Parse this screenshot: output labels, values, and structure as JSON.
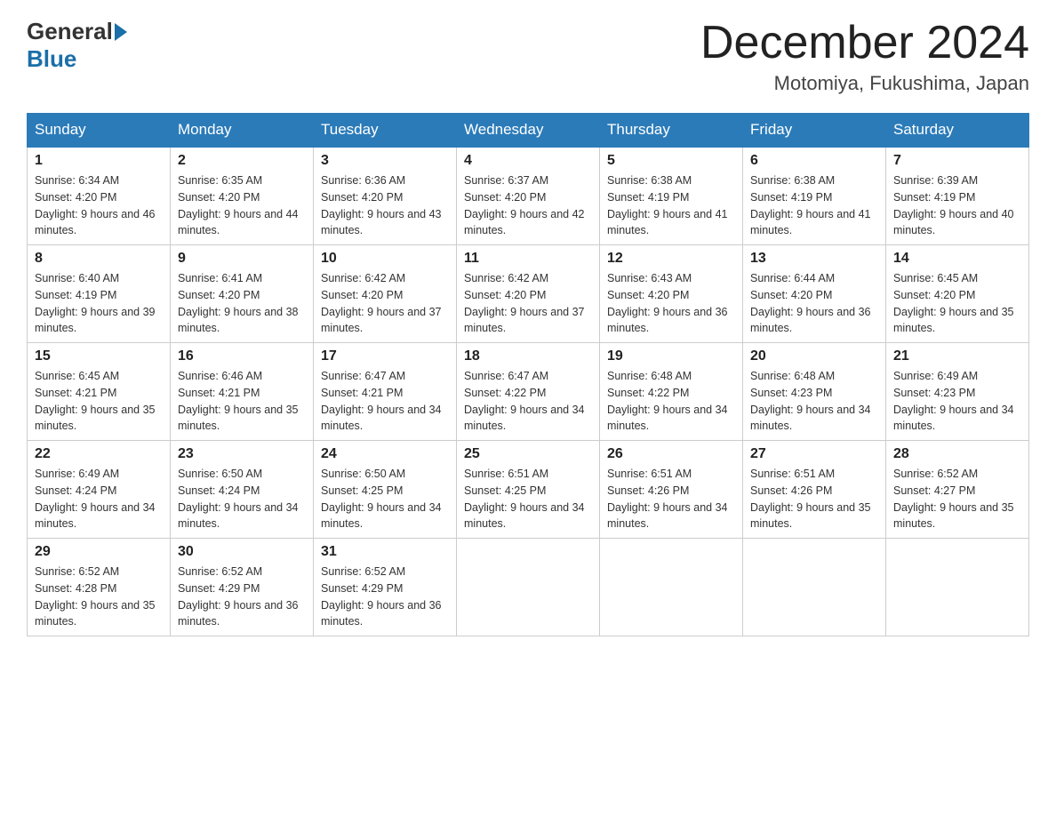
{
  "header": {
    "logo_general": "General",
    "logo_blue": "Blue",
    "month_title": "December 2024",
    "location": "Motomiya, Fukushima, Japan"
  },
  "days_of_week": [
    "Sunday",
    "Monday",
    "Tuesday",
    "Wednesday",
    "Thursday",
    "Friday",
    "Saturday"
  ],
  "weeks": [
    [
      {
        "num": "1",
        "sunrise": "6:34 AM",
        "sunset": "4:20 PM",
        "daylight": "9 hours and 46 minutes."
      },
      {
        "num": "2",
        "sunrise": "6:35 AM",
        "sunset": "4:20 PM",
        "daylight": "9 hours and 44 minutes."
      },
      {
        "num": "3",
        "sunrise": "6:36 AM",
        "sunset": "4:20 PM",
        "daylight": "9 hours and 43 minutes."
      },
      {
        "num": "4",
        "sunrise": "6:37 AM",
        "sunset": "4:20 PM",
        "daylight": "9 hours and 42 minutes."
      },
      {
        "num": "5",
        "sunrise": "6:38 AM",
        "sunset": "4:19 PM",
        "daylight": "9 hours and 41 minutes."
      },
      {
        "num": "6",
        "sunrise": "6:38 AM",
        "sunset": "4:19 PM",
        "daylight": "9 hours and 41 minutes."
      },
      {
        "num": "7",
        "sunrise": "6:39 AM",
        "sunset": "4:19 PM",
        "daylight": "9 hours and 40 minutes."
      }
    ],
    [
      {
        "num": "8",
        "sunrise": "6:40 AM",
        "sunset": "4:19 PM",
        "daylight": "9 hours and 39 minutes."
      },
      {
        "num": "9",
        "sunrise": "6:41 AM",
        "sunset": "4:20 PM",
        "daylight": "9 hours and 38 minutes."
      },
      {
        "num": "10",
        "sunrise": "6:42 AM",
        "sunset": "4:20 PM",
        "daylight": "9 hours and 37 minutes."
      },
      {
        "num": "11",
        "sunrise": "6:42 AM",
        "sunset": "4:20 PM",
        "daylight": "9 hours and 37 minutes."
      },
      {
        "num": "12",
        "sunrise": "6:43 AM",
        "sunset": "4:20 PM",
        "daylight": "9 hours and 36 minutes."
      },
      {
        "num": "13",
        "sunrise": "6:44 AM",
        "sunset": "4:20 PM",
        "daylight": "9 hours and 36 minutes."
      },
      {
        "num": "14",
        "sunrise": "6:45 AM",
        "sunset": "4:20 PM",
        "daylight": "9 hours and 35 minutes."
      }
    ],
    [
      {
        "num": "15",
        "sunrise": "6:45 AM",
        "sunset": "4:21 PM",
        "daylight": "9 hours and 35 minutes."
      },
      {
        "num": "16",
        "sunrise": "6:46 AM",
        "sunset": "4:21 PM",
        "daylight": "9 hours and 35 minutes."
      },
      {
        "num": "17",
        "sunrise": "6:47 AM",
        "sunset": "4:21 PM",
        "daylight": "9 hours and 34 minutes."
      },
      {
        "num": "18",
        "sunrise": "6:47 AM",
        "sunset": "4:22 PM",
        "daylight": "9 hours and 34 minutes."
      },
      {
        "num": "19",
        "sunrise": "6:48 AM",
        "sunset": "4:22 PM",
        "daylight": "9 hours and 34 minutes."
      },
      {
        "num": "20",
        "sunrise": "6:48 AM",
        "sunset": "4:23 PM",
        "daylight": "9 hours and 34 minutes."
      },
      {
        "num": "21",
        "sunrise": "6:49 AM",
        "sunset": "4:23 PM",
        "daylight": "9 hours and 34 minutes."
      }
    ],
    [
      {
        "num": "22",
        "sunrise": "6:49 AM",
        "sunset": "4:24 PM",
        "daylight": "9 hours and 34 minutes."
      },
      {
        "num": "23",
        "sunrise": "6:50 AM",
        "sunset": "4:24 PM",
        "daylight": "9 hours and 34 minutes."
      },
      {
        "num": "24",
        "sunrise": "6:50 AM",
        "sunset": "4:25 PM",
        "daylight": "9 hours and 34 minutes."
      },
      {
        "num": "25",
        "sunrise": "6:51 AM",
        "sunset": "4:25 PM",
        "daylight": "9 hours and 34 minutes."
      },
      {
        "num": "26",
        "sunrise": "6:51 AM",
        "sunset": "4:26 PM",
        "daylight": "9 hours and 34 minutes."
      },
      {
        "num": "27",
        "sunrise": "6:51 AM",
        "sunset": "4:26 PM",
        "daylight": "9 hours and 35 minutes."
      },
      {
        "num": "28",
        "sunrise": "6:52 AM",
        "sunset": "4:27 PM",
        "daylight": "9 hours and 35 minutes."
      }
    ],
    [
      {
        "num": "29",
        "sunrise": "6:52 AM",
        "sunset": "4:28 PM",
        "daylight": "9 hours and 35 minutes."
      },
      {
        "num": "30",
        "sunrise": "6:52 AM",
        "sunset": "4:29 PM",
        "daylight": "9 hours and 36 minutes."
      },
      {
        "num": "31",
        "sunrise": "6:52 AM",
        "sunset": "4:29 PM",
        "daylight": "9 hours and 36 minutes."
      },
      null,
      null,
      null,
      null
    ]
  ]
}
